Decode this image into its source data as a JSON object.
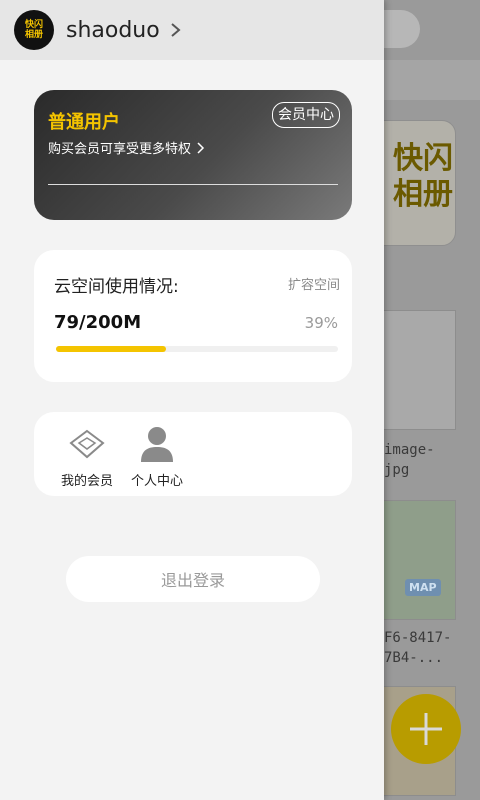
{
  "app": {
    "logo_text": "快闪相册"
  },
  "drawer": {
    "username": "shaoduo",
    "member_card": {
      "title": "普通用户",
      "subtitle": "购买会员可享受更多特权",
      "center_button": "会员中心"
    },
    "storage": {
      "title": "云空间使用情况:",
      "expand_link": "扩容空间",
      "amount": "79/200M",
      "percent_text": "39%",
      "progress": 0.39
    },
    "shortcuts": [
      {
        "label": "我的会员",
        "icon": "diamond-icon"
      },
      {
        "label": "个人中心",
        "icon": "user-icon"
      }
    ],
    "logout_label": "退出登录"
  },
  "background": {
    "card_glyph": "快闪相册",
    "items": [
      {
        "label_line1": "image-",
        "label_line2": "jpg"
      },
      {
        "label_line1": "F6-8417-",
        "label_line2": "7B4-..."
      }
    ],
    "map_badge": "MAP"
  },
  "colors": {
    "accent": "#f4c400",
    "drawer_bg": "#f3f3f3"
  }
}
